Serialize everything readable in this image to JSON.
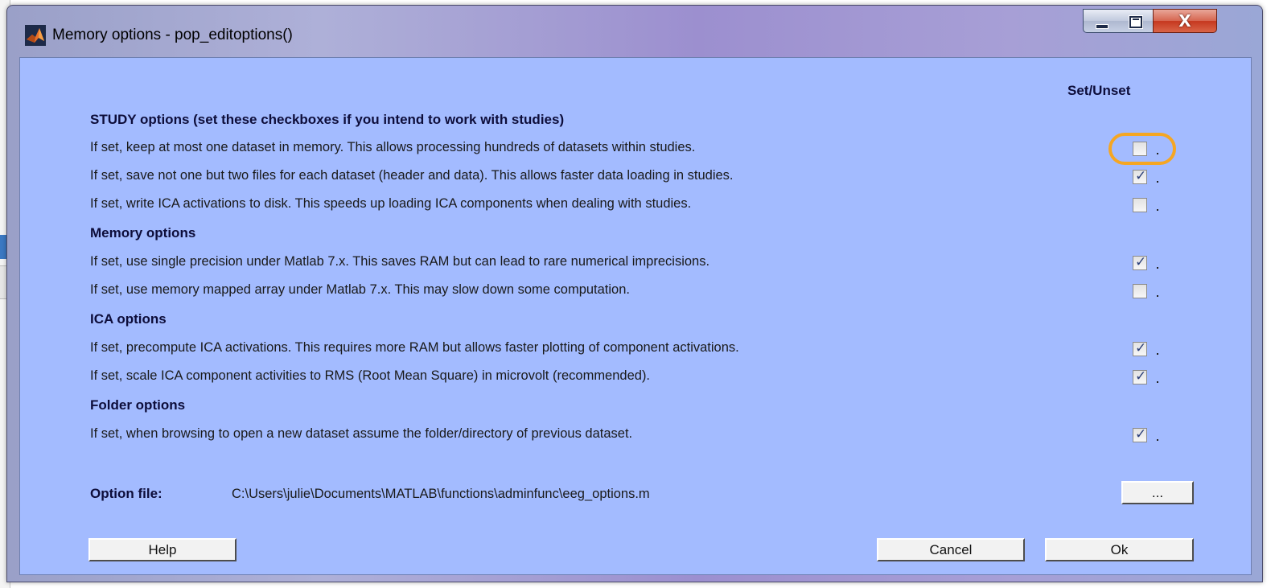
{
  "window": {
    "title": "Memory options - pop_editoptions()",
    "controls": {
      "minimize": "minimize",
      "maximize": "maximize",
      "close": "X"
    }
  },
  "column_header": "Set/Unset",
  "sections": [
    {
      "header": "STUDY options (set these checkboxes if you intend to work with studies)",
      "options": [
        {
          "label": "If set, keep at most one dataset in memory. This allows processing hundreds of datasets within studies.",
          "checked": false
        },
        {
          "label": "If set, save not one but two files for each dataset (header and data). This allows faster data loading in studies.",
          "checked": true
        },
        {
          "label": "If set, write ICA activations to disk. This speeds up loading ICA components when dealing with studies.",
          "checked": false
        }
      ]
    },
    {
      "header": "Memory options",
      "options": [
        {
          "label": "If set, use single precision under Matlab 7.x. This saves RAM but can lead to rare numerical imprecisions.",
          "checked": true
        },
        {
          "label": "If set, use memory mapped array under Matlab 7.x. This may slow down some computation.",
          "checked": false
        }
      ]
    },
    {
      "header": "ICA options",
      "options": [
        {
          "label": "If set, precompute ICA activations. This requires more RAM but allows faster plotting of component activations.",
          "checked": true
        },
        {
          "label": "If set, scale ICA component activities to RMS (Root Mean Square) in microvolt (recommended).",
          "checked": true
        }
      ]
    },
    {
      "header": "Folder options",
      "options": [
        {
          "label": "If set, when browsing to open a new dataset assume the folder/directory of previous dataset.",
          "checked": true
        }
      ]
    }
  ],
  "option_file": {
    "label": "Option file:",
    "path": "C:\\Users\\julie\\Documents\\MATLAB\\functions\\adminfunc\\eeg_options.m",
    "browse_label": "..."
  },
  "buttons": {
    "help": "Help",
    "cancel": "Cancel",
    "ok": "Ok"
  },
  "colors": {
    "client_bg": "#a3bbff",
    "highlight": "#f5a623"
  }
}
